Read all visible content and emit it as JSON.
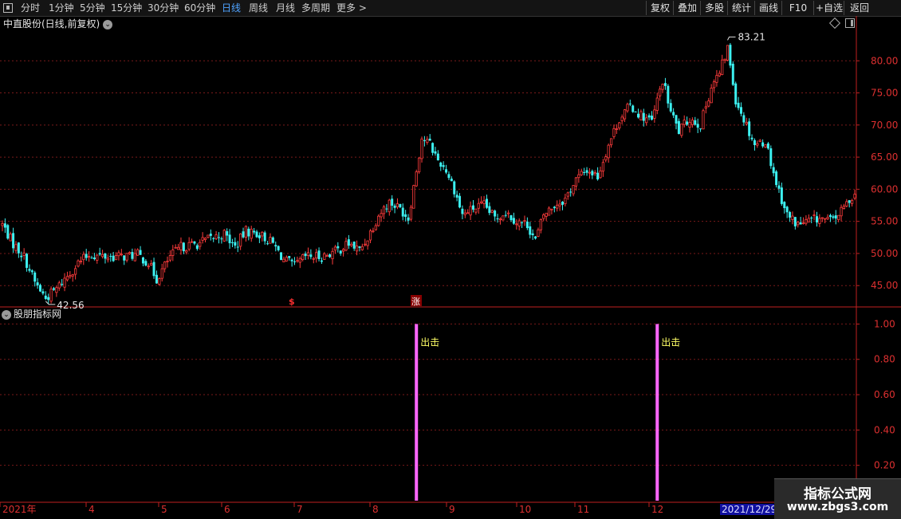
{
  "toolbar": {
    "periods": [
      {
        "label": "分时",
        "active": false
      },
      {
        "label": "1分钟",
        "active": false
      },
      {
        "label": "5分钟",
        "active": false
      },
      {
        "label": "15分钟",
        "active": false
      },
      {
        "label": "30分钟",
        "active": false
      },
      {
        "label": "60分钟",
        "active": false
      },
      {
        "label": "日线",
        "active": true
      },
      {
        "label": "周线",
        "active": false
      },
      {
        "label": "月线",
        "active": false
      },
      {
        "label": "多周期",
        "active": false
      },
      {
        "label": "更多 >",
        "active": false
      }
    ],
    "right_buttons": [
      "复权",
      "叠加",
      "多股",
      "统计",
      "画线",
      "F10",
      "+自选",
      "返回"
    ]
  },
  "main_panel": {
    "title": "中直股份(日线,前复权)",
    "price_max_label": "83.21",
    "price_min_label": "42.56",
    "markers": [
      "$",
      "涨"
    ]
  },
  "sub_panel": {
    "title": "股朋指标网",
    "signal_label": "出击"
  },
  "colors": {
    "up": "#ff3c3c",
    "down": "#3cf0f0",
    "grid": "#7a1a1a",
    "axis": "#c02020",
    "axis_text": "#dd3030",
    "signal": "#ff66ff",
    "signal_text": "#ffff66",
    "date_highlight": "#1010a0"
  },
  "timeline": {
    "labels": [
      "2021年",
      "4",
      "5",
      "6",
      "7",
      "8",
      "9",
      "10",
      "11",
      "12"
    ],
    "highlight": "2021/12/29/"
  },
  "watermark": {
    "line1": "指标公式网",
    "line2": "www.zbgs3.com"
  },
  "chart_data": [
    {
      "type": "candlestick",
      "title": "中直股份(日线,前复权)",
      "y_ticks": [
        45,
        50,
        55,
        60,
        65,
        70,
        75,
        80
      ],
      "ylim": [
        41.8,
        84.5
      ],
      "annotations": [
        {
          "label": "83.21",
          "value": 83.21
        },
        {
          "label": "42.56",
          "value": 42.56
        }
      ],
      "x_labels": [
        "2021年",
        "4",
        "5",
        "6",
        "7",
        "8",
        "9",
        "10",
        "11",
        "12"
      ],
      "close_path": [
        {
          "i": 0,
          "v": 54.5
        },
        {
          "i": 4,
          "v": 51.5
        },
        {
          "i": 8,
          "v": 49.5
        },
        {
          "i": 12,
          "v": 45.5
        },
        {
          "i": 16,
          "v": 43.0
        },
        {
          "i": 20,
          "v": 44.5
        },
        {
          "i": 24,
          "v": 46.5
        },
        {
          "i": 28,
          "v": 48.5
        },
        {
          "i": 32,
          "v": 49.8
        },
        {
          "i": 38,
          "v": 49.5
        },
        {
          "i": 44,
          "v": 49.5
        },
        {
          "i": 50,
          "v": 49.8
        },
        {
          "i": 54,
          "v": 48.5
        },
        {
          "i": 57,
          "v": 46.0
        },
        {
          "i": 62,
          "v": 49.5
        },
        {
          "i": 66,
          "v": 51.0
        },
        {
          "i": 72,
          "v": 51.5
        },
        {
          "i": 78,
          "v": 52.5
        },
        {
          "i": 82,
          "v": 53.0
        },
        {
          "i": 86,
          "v": 51.0
        },
        {
          "i": 90,
          "v": 53.5
        },
        {
          "i": 95,
          "v": 53.0
        },
        {
          "i": 100,
          "v": 51.5
        },
        {
          "i": 104,
          "v": 49.0
        },
        {
          "i": 108,
          "v": 48.0
        },
        {
          "i": 112,
          "v": 49.5
        },
        {
          "i": 118,
          "v": 49.5
        },
        {
          "i": 124,
          "v": 50.5
        },
        {
          "i": 128,
          "v": 51.5
        },
        {
          "i": 132,
          "v": 50.5
        },
        {
          "i": 135,
          "v": 52.5
        },
        {
          "i": 139,
          "v": 56.0
        },
        {
          "i": 143,
          "v": 58.0
        },
        {
          "i": 147,
          "v": 57.0
        },
        {
          "i": 150,
          "v": 55.5
        },
        {
          "i": 152,
          "v": 60.5
        },
        {
          "i": 155,
          "v": 68.0
        },
        {
          "i": 158,
          "v": 67.0
        },
        {
          "i": 161,
          "v": 64.5
        },
        {
          "i": 164,
          "v": 63.0
        },
        {
          "i": 167,
          "v": 60.0
        },
        {
          "i": 170,
          "v": 56.0
        },
        {
          "i": 174,
          "v": 57.0
        },
        {
          "i": 178,
          "v": 57.5
        },
        {
          "i": 182,
          "v": 55.5
        },
        {
          "i": 186,
          "v": 56.5
        },
        {
          "i": 190,
          "v": 55.0
        },
        {
          "i": 194,
          "v": 54.5
        },
        {
          "i": 197,
          "v": 52.0
        },
        {
          "i": 200,
          "v": 56.0
        },
        {
          "i": 204,
          "v": 57.5
        },
        {
          "i": 208,
          "v": 58.5
        },
        {
          "i": 212,
          "v": 61.5
        },
        {
          "i": 216,
          "v": 63.0
        },
        {
          "i": 220,
          "v": 62.0
        },
        {
          "i": 224,
          "v": 67.0
        },
        {
          "i": 228,
          "v": 71.0
        },
        {
          "i": 232,
          "v": 73.0
        },
        {
          "i": 236,
          "v": 71.5
        },
        {
          "i": 240,
          "v": 70.5
        },
        {
          "i": 244,
          "v": 77.0
        },
        {
          "i": 247,
          "v": 72.0
        },
        {
          "i": 250,
          "v": 69.0
        },
        {
          "i": 254,
          "v": 71.0
        },
        {
          "i": 258,
          "v": 70.0
        },
        {
          "i": 262,
          "v": 76.0
        },
        {
          "i": 265,
          "v": 78.0
        },
        {
          "i": 268,
          "v": 82.0
        },
        {
          "i": 271,
          "v": 74.0
        },
        {
          "i": 274,
          "v": 71.0
        },
        {
          "i": 278,
          "v": 67.0
        },
        {
          "i": 282,
          "v": 67.5
        },
        {
          "i": 286,
          "v": 61.0
        },
        {
          "i": 290,
          "v": 56.0
        },
        {
          "i": 294,
          "v": 54.5
        },
        {
          "i": 298,
          "v": 55.0
        },
        {
          "i": 302,
          "v": 55.5
        },
        {
          "i": 306,
          "v": 55.0
        },
        {
          "i": 310,
          "v": 56.5
        },
        {
          "i": 314,
          "v": 59.0
        }
      ],
      "candle_count": 316
    },
    {
      "type": "bar",
      "title": "股朋指标网",
      "y_ticks": [
        0.2,
        0.4,
        0.6,
        0.8,
        1.0
      ],
      "ylim": [
        0,
        1.02
      ],
      "signals": [
        {
          "i": 153,
          "value": 1.0,
          "label": "出击"
        },
        {
          "i": 242,
          "value": 1.0,
          "label": "出击"
        }
      ]
    }
  ]
}
